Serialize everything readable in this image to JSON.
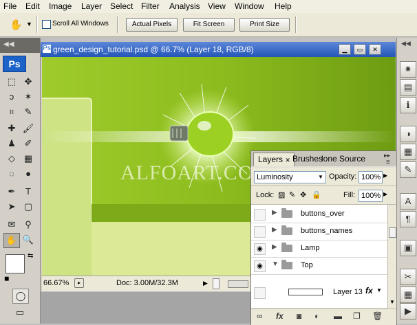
{
  "menu": [
    "File",
    "Edit",
    "Image",
    "Layer",
    "Select",
    "Filter",
    "Analysis",
    "View",
    "Window",
    "Help"
  ],
  "options": {
    "scroll_all": "Scroll All Windows",
    "actual_pixels": "Actual Pixels",
    "fit_screen": "Fit Screen",
    "print_size": "Print Size"
  },
  "toolbox": {
    "logo": "Ps"
  },
  "document": {
    "title": "green_design_tutorial.psd @ 66.7% (Layer 18, RGB/8)",
    "watermark": "ALFOART.COM",
    "zoom": "66.67%",
    "doc_info": "Doc: 3.00M/32.3M"
  },
  "layers_panel": {
    "tabs": [
      "Layers",
      "Brushes",
      "lone Source"
    ],
    "blend_mode": "Luminosity",
    "opacity_label": "Opacity:",
    "opacity_value": "100%",
    "lock_label": "Lock:",
    "fill_label": "Fill:",
    "fill_value": "100%",
    "layers": [
      {
        "name": "buttons_over",
        "visible": false
      },
      {
        "name": "buttons_names",
        "visible": false
      },
      {
        "name": "Lamp",
        "visible": true
      },
      {
        "name": "Top",
        "visible": true
      },
      {
        "name": "Layer 13",
        "visible": false
      }
    ]
  },
  "colors": {
    "accent": "#2456b7",
    "canvas": "#8fbf1f",
    "panel": "#e3e0d8"
  }
}
